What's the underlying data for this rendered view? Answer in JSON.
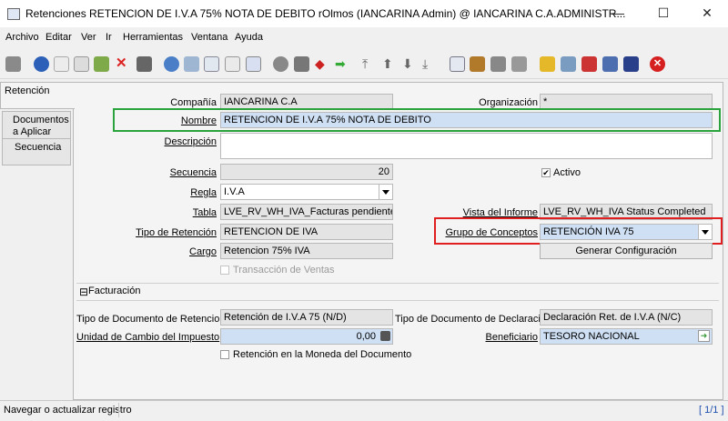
{
  "window": {
    "title": "Retenciones  RETENCION DE I.V.A 75% NOTA DE DEBITO  rOlmos (IANCARINA Admin) @ IANCARINA C.A.ADMINISTR...",
    "minimize": "—",
    "maximize": "☐",
    "close": "✕"
  },
  "menu": [
    "Archivo",
    "Editar",
    "Ver",
    "Ir",
    "Herramientas",
    "Ventana",
    "Ayuda"
  ],
  "toolbar_icons": [
    "undo-icon",
    "help-icon",
    "new-icon",
    "copy-icon",
    "save-icon",
    "delete-icon",
    "save-db-icon",
    "refresh-icon",
    "find-icon",
    "attach-icon",
    "chat-icon",
    "grid-toggle-icon",
    "history-icon",
    "home-icon",
    "prev-icon",
    "next-icon",
    "first-icon",
    "up-icon",
    "down-icon",
    "last-icon",
    "report-icon",
    "archive-icon",
    "print-preview-icon",
    "print-icon",
    "lock-icon",
    "zoom-across-icon",
    "workflow-icon",
    "product-icon",
    "user-icon",
    "close-window-icon"
  ],
  "tabs": [
    "Retención",
    "Documentos a Aplicar",
    "Secuencia"
  ],
  "form": {
    "compania_label": "Compañía",
    "compania_value": "IANCARINA C.A",
    "organizacion_label": "Organización",
    "organizacion_value": "*",
    "nombre_label": "Nombre",
    "nombre_value": "RETENCION DE I.V.A 75% NOTA DE DEBITO",
    "descripcion_label": "Descripción",
    "descripcion_value": "",
    "secuencia_label": "Secuencia",
    "secuencia_value": "20",
    "activo_label": "Activo",
    "regla_label": "Regla",
    "regla_value": "I.V.A",
    "tabla_label": "Tabla",
    "tabla_value": "LVE_RV_WH_IVA_Facturas pendientes po",
    "vista_label": "Vista del Informe",
    "vista_value": "LVE_RV_WH_IVA Status Completed",
    "tipo_ret_label": "Tipo de Retención",
    "tipo_ret_value": "RETENCION DE IVA",
    "grupo_label": "Grupo de Conceptos",
    "grupo_value": "RETENCIÓN IVA 75",
    "cargo_label": "Cargo",
    "cargo_value": "Retencion 75% IVA",
    "generar_button": "Generar Configuración",
    "transaccion_label": "Transacción de Ventas"
  },
  "facturacion": {
    "section_label": "Facturación",
    "collapse_glyph": "⊟",
    "tipo_doc_ret_label": "Tipo de Documento de Retencion",
    "tipo_doc_ret_value": "Retención de I.V.A 75 (N/D)",
    "tipo_doc_decl_label": "Tipo de Documento de Declaracion",
    "tipo_doc_decl_value": "Declaración Ret. de I.V.A (N/C)",
    "unidad_label": "Unidad de Cambio del Impuesto",
    "unidad_value": "0,00",
    "beneficiario_label": "Beneficiario",
    "beneficiario_value": "TESORO NACIONAL",
    "moneda_label": "Retención en la Moneda del Documento"
  },
  "status": {
    "message": "Navegar o actualizar registro",
    "record": "[ 1/1 ]"
  },
  "colors": {
    "highlight_green": "#2aa33c",
    "highlight_red": "#e02020",
    "field_blue": "#cfe0f4"
  }
}
